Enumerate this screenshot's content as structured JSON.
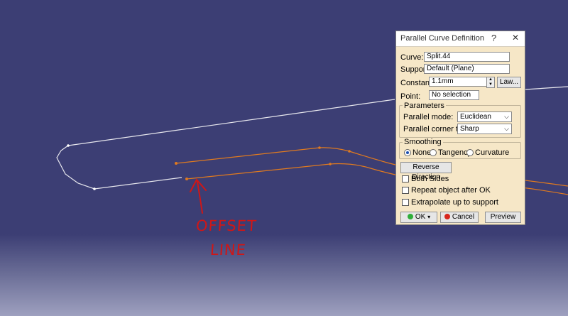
{
  "annotation": {
    "line1": "OFFSET",
    "line2": "LINE"
  },
  "dialog": {
    "title": "Parallel Curve Definition",
    "help_glyph": "?",
    "close_glyph": "✕",
    "curve": {
      "label": "Curve:",
      "value": "Split.44"
    },
    "support": {
      "label": "Support:",
      "value": "Default (Plane)"
    },
    "constant": {
      "label": "Constant:",
      "value": "1.1mm",
      "law_button": "Law..."
    },
    "point": {
      "label": "Point:",
      "value": "No selection"
    },
    "parameters": {
      "title": "Parameters",
      "parallel_mode_label": "Parallel mode:",
      "parallel_mode_value": "Euclidean",
      "corner_type_label": "Parallel corner type:",
      "corner_type_value": "Sharp"
    },
    "smoothing": {
      "title": "Smoothing",
      "options": [
        "None",
        "Tangency",
        "Curvature"
      ],
      "selected": "None"
    },
    "reverse_direction": "Reverse Direction",
    "checkboxes": {
      "both_sides": "Both Sides",
      "repeat": "Repeat object after OK",
      "extrapolate": "Extrapolate up to support"
    },
    "buttons": {
      "ok": "OK",
      "cancel": "Cancel",
      "preview": "Preview"
    }
  },
  "colors": {
    "background": "#3c3e74",
    "curve": "#ffffff",
    "offset": "#e07a1f",
    "annotation": "#d01616",
    "dialog": "#f6e7c7"
  }
}
